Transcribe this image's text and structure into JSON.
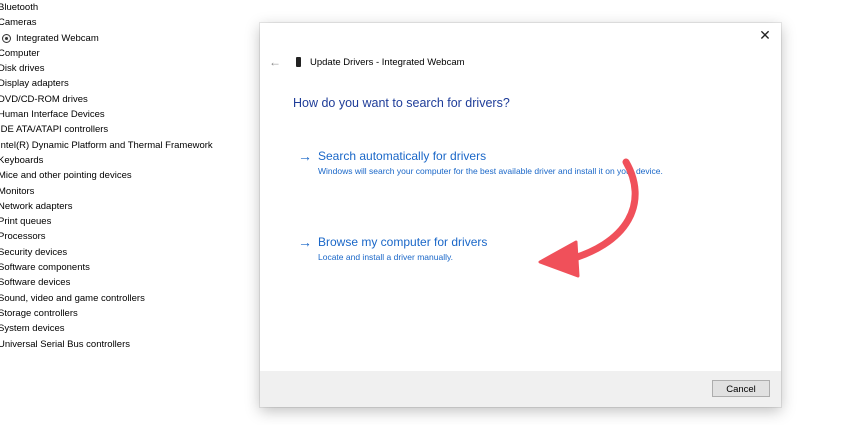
{
  "device_tree": {
    "items": [
      {
        "label": "Bluetooth"
      },
      {
        "label": "Cameras"
      },
      {
        "label": "Integrated Webcam",
        "child": true,
        "icon": "webcam-icon"
      },
      {
        "label": "Computer"
      },
      {
        "label": "Disk drives"
      },
      {
        "label": "Display adapters"
      },
      {
        "label": "DVD/CD-ROM drives"
      },
      {
        "label": "Human Interface Devices"
      },
      {
        "label": "IDE ATA/ATAPI controllers"
      },
      {
        "label": "Intel(R) Dynamic Platform and Thermal Framework"
      },
      {
        "label": "Keyboards"
      },
      {
        "label": "Mice and other pointing devices"
      },
      {
        "label": "Monitors"
      },
      {
        "label": "Network adapters"
      },
      {
        "label": "Print queues"
      },
      {
        "label": "Processors"
      },
      {
        "label": "Security devices"
      },
      {
        "label": "Software components"
      },
      {
        "label": "Software devices"
      },
      {
        "label": "Sound, video and game controllers"
      },
      {
        "label": "Storage controllers"
      },
      {
        "label": "System devices"
      },
      {
        "label": "Universal Serial Bus controllers"
      }
    ]
  },
  "dialog": {
    "close_glyph": "✕",
    "back_glyph": "←",
    "title": "Update Drivers - Integrated Webcam",
    "heading": "How do you want to search for drivers?",
    "options": [
      {
        "arrow_glyph": "→",
        "title": "Search automatically for drivers",
        "description": "Windows will search your computer for the best available driver and install it on your device."
      },
      {
        "arrow_glyph": "→",
        "title": "Browse my computer for drivers",
        "description": "Locate and install a driver manually."
      }
    ],
    "cancel_label": "Cancel"
  },
  "colors": {
    "link_blue": "#1a67c8",
    "heading_blue": "#1f3d99",
    "annotation_red": "#f0505a",
    "footer_gray": "#f0f0f0"
  }
}
